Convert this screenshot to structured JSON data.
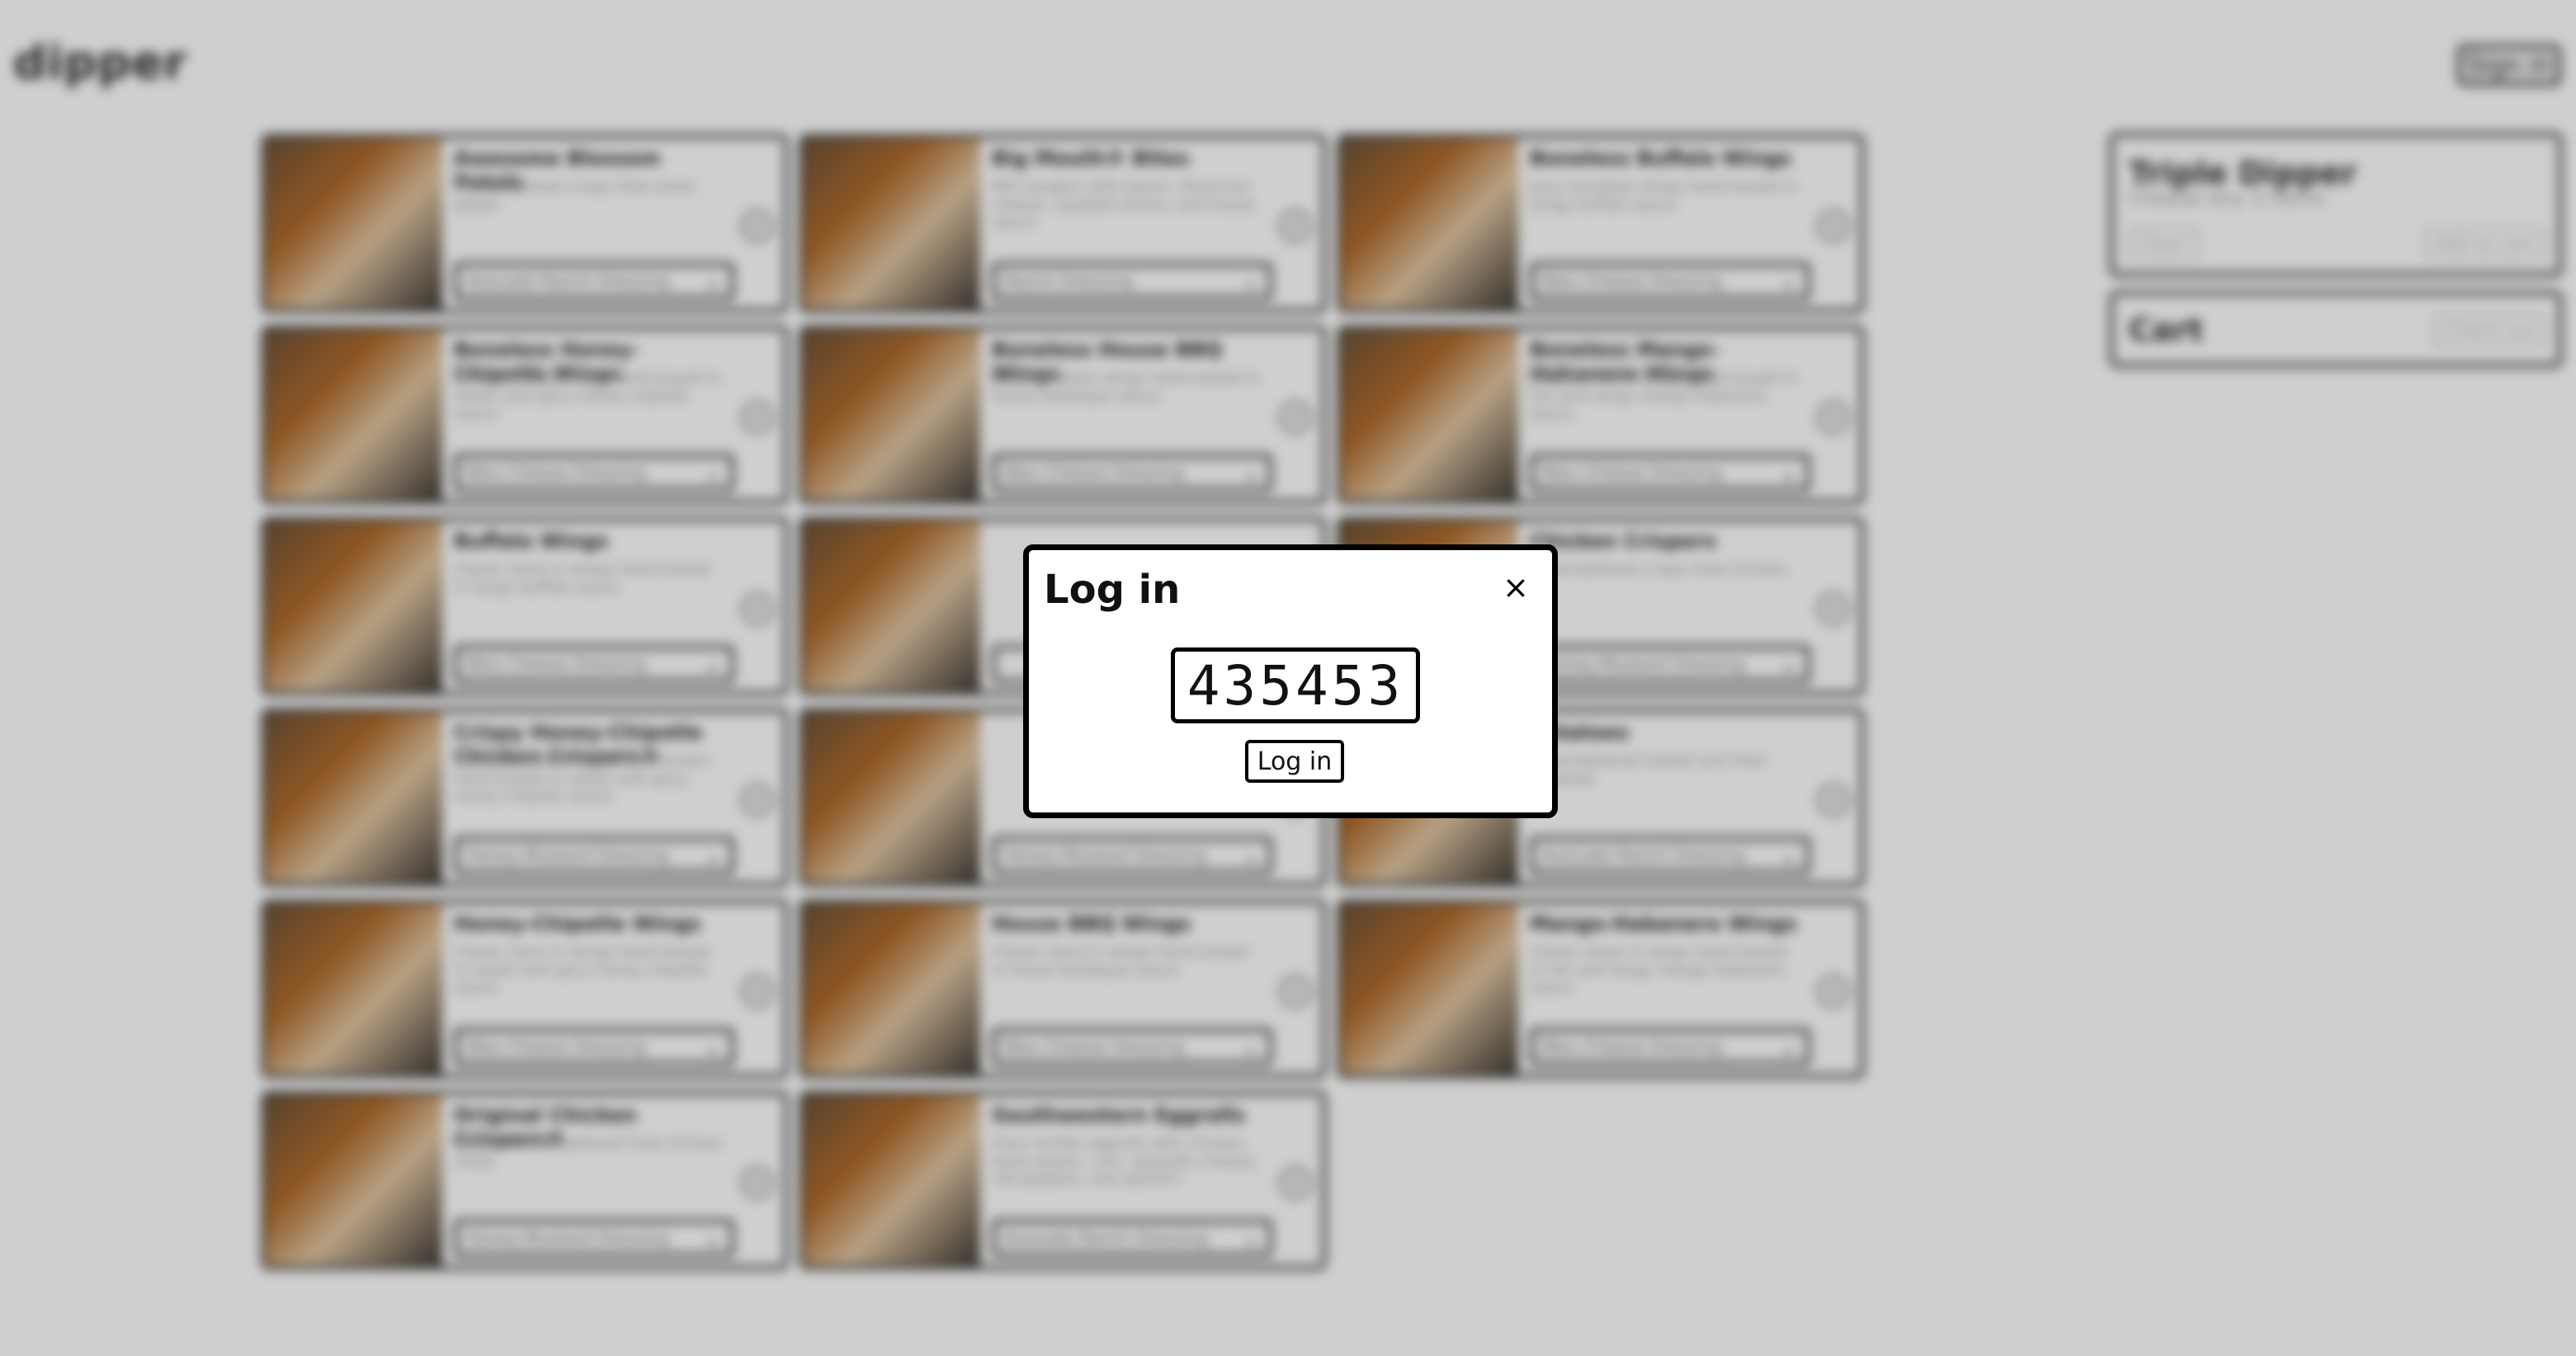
{
  "header": {
    "logo": "dipper",
    "sign_in_label": "Sign in"
  },
  "menu": {
    "items": [
      {
        "title": "Awesome Blossom Petals",
        "desc": "Hand-battered crispy fried onion petals",
        "sauce": "Avocado Ranch Dressing"
      },
      {
        "title": "Big Mouth® Bites",
        "desc": "Mini burgers with bacon, American cheese, sautéed onions, and house sauce",
        "sauce": "Ranch Dressing"
      },
      {
        "title": "Boneless Buffalo Wings",
        "desc": "Juicy boneless wings hand-tossed in tangy buffalo sauce",
        "sauce": "Bleu Cheese Dressing"
      },
      {
        "title": "Boneless Honey-Chipotle Wings",
        "desc": "Juicy boneless wings hand-tossed in sweet and spicy honey-chipotle sauce",
        "sauce": "Bleu Cheese Dressing"
      },
      {
        "title": "Boneless House BBQ Wings",
        "desc": "Juicy boneless wings hand-tossed in house barbeque sauce",
        "sauce": "Bleu Cheese Dressing"
      },
      {
        "title": "Boneless Mango-Habanero Wings",
        "desc": "Juicy boneless wings hand-tossed in hot and tangy mango-habanero sauce",
        "sauce": "Bleu Cheese Dressing"
      },
      {
        "title": "Buffalo Wings",
        "desc": "Classic bone-in wings hand-tossed in tangy buffalo sauce",
        "sauce": "Bleu Cheese Dressing"
      },
      {
        "title": "",
        "desc": "",
        "sauce": ""
      },
      {
        "title": "Chicken Crispers",
        "desc": "Hand-battered crispy fried chicken",
        "sauce": "Honey-Mustard Dressing"
      },
      {
        "title": "Crispy Honey-Chipotle Chicken Crispers®",
        "desc": "Hand-battered crispy fried chicken hand-tossed in sweet and spicy honey-chipotle sauce",
        "sauce": "Honey-Mustard Dressing"
      },
      {
        "title": "",
        "desc": "",
        "sauce": "Honey-Mustard Dressing"
      },
      {
        "title": "Potatoes",
        "desc": "Hand-battered loaded and fried potatoes",
        "sauce": "Avocado Ranch Dressing"
      },
      {
        "title": "Honey-Chipotle Wings",
        "desc": "Classic bone-in wings hand-tossed in sweet and spicy honey-chipotle sauce",
        "sauce": "Bleu Cheese Dressing"
      },
      {
        "title": "House BBQ Wings",
        "desc": "Classic bone-in wings hand-tossed in house barbeque sauce",
        "sauce": "Bleu Cheese Dressing"
      },
      {
        "title": "Mango-Habanero Wings",
        "desc": "Classic bone-in wings hand-tossed in hot and tangy mango-habanero sauce",
        "sauce": "Bleu Cheese Dressing"
      },
      {
        "title": "Original Chicken Crispers®",
        "desc": "Original hand-battered fried chicken strips",
        "sauce": "Honey-Mustard Dressing"
      },
      {
        "title": "Southwestern Eggrolls",
        "desc": "Flour tortilla eggrolls with chicken, black beans, corn, jalapeño cheese, red peppers, and spinach",
        "sauce": "Avocado Ranch Dressing"
      }
    ]
  },
  "triple_dipper": {
    "title": "Triple Dipper",
    "subtitle": "Choose any 3 items",
    "clear_label": "Clear",
    "add_label": "Add to cart"
  },
  "cart": {
    "title": "Cart",
    "checkout_label": "Check out"
  },
  "login_modal": {
    "title": "Log in",
    "close_symbol": "×",
    "code": "435453",
    "button_label": "Log in"
  }
}
